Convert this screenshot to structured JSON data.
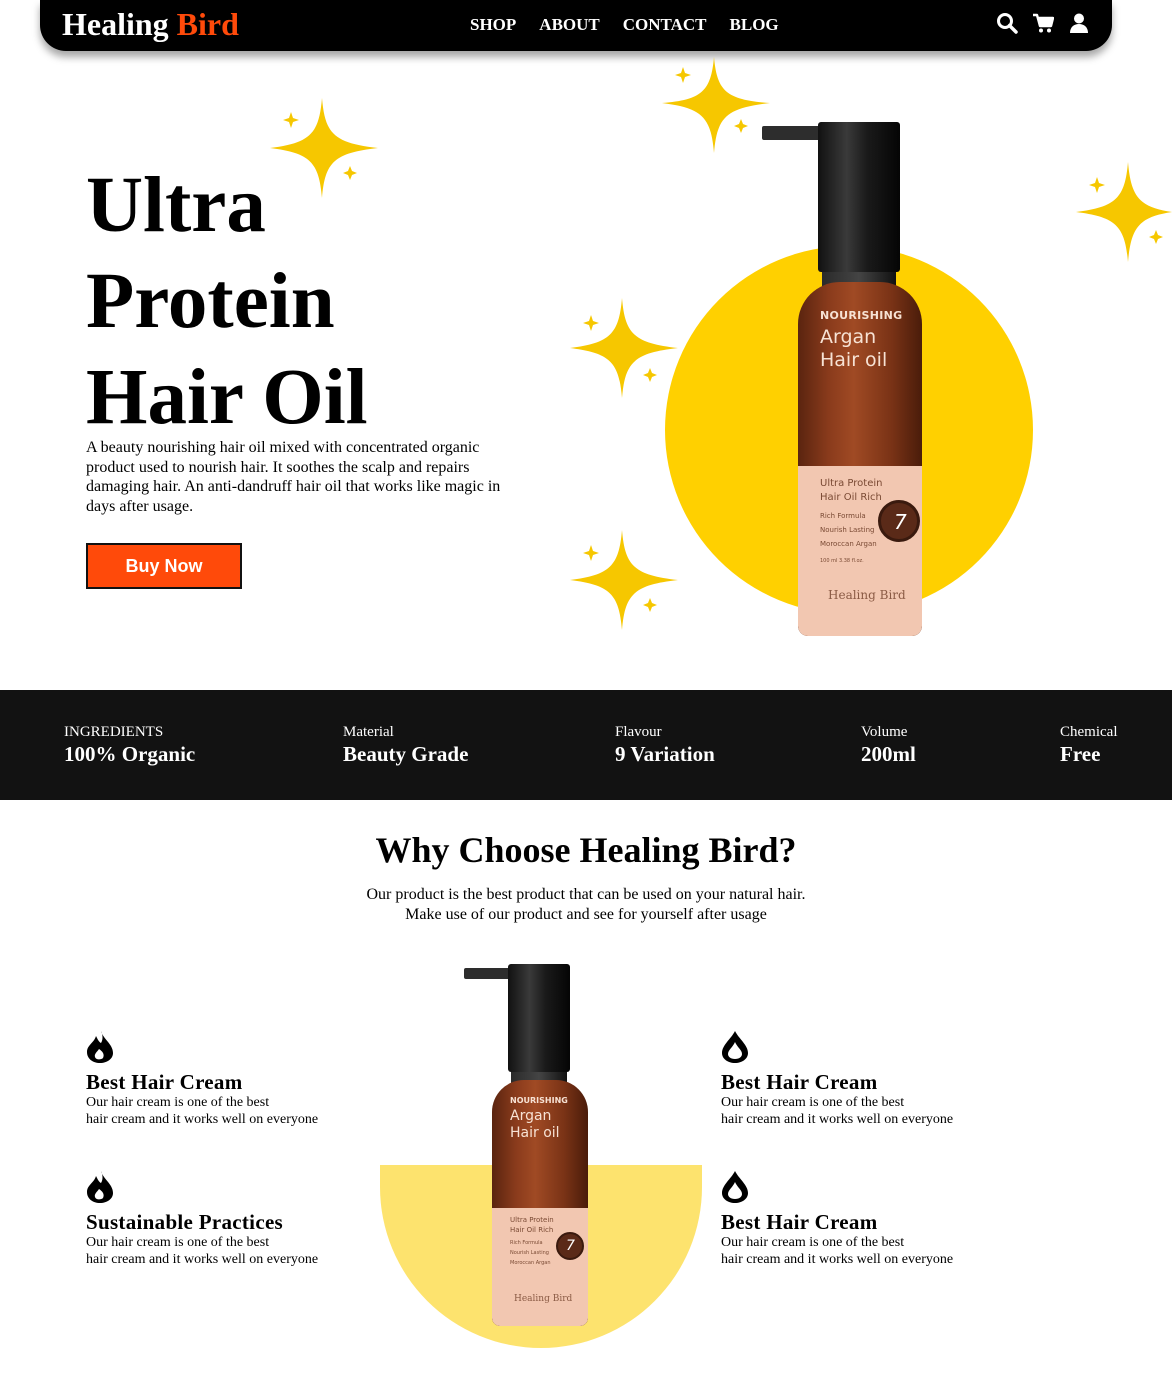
{
  "nav": {
    "brand_first": "Healing",
    "brand_second": "Bird",
    "links": [
      "SHOP",
      "ABOUT",
      "CONTACT",
      "BLOG"
    ],
    "icons": [
      "search-icon",
      "cart-icon",
      "user-icon"
    ]
  },
  "hero": {
    "title_lines": [
      "Ultra",
      "Protein",
      "Hair Oil"
    ],
    "description": "A beauty nourishing hair oil mixed with concentrated organic product used to nourish hair. It soothes the scalp and repairs damaging hair. An anti-dandruff hair oil that works like magic in days after usage.",
    "button_label": "Buy Now"
  },
  "product_label": {
    "line1": "NOURISHING",
    "line2": "Argan",
    "line3": "Hair oil",
    "sub1": "Ultra Protein",
    "sub2": "Hair Oil Rich",
    "sub3": "Rich Formula",
    "sub4": "Nourish Lasting",
    "sub5": "Moroccan Argan",
    "volume": "100 ml 3.38 fl.oz.",
    "seal_number": "7",
    "brand": "Healing Bird"
  },
  "stats": [
    {
      "label": "INGREDIENTS",
      "value": "100% Organic"
    },
    {
      "label": "Material",
      "value": "Beauty Grade"
    },
    {
      "label": "Flavour",
      "value": "9 Variation"
    },
    {
      "label": "Volume",
      "value": "200ml"
    },
    {
      "label": "Chemical",
      "value": "Free"
    }
  ],
  "why": {
    "title": "Why Choose Healing Bird?",
    "subtitle_lines": [
      "Our product is the best product that can be used on your natural hair.",
      "Make use of our product and see for yourself after usage"
    ]
  },
  "features": [
    {
      "title": "Best Hair Cream",
      "lines": [
        "Our hair cream is one of the best",
        "hair cream and it works well on everyone"
      ],
      "icon": "flame-drop-icon"
    },
    {
      "title": "Best Hair Cream",
      "lines": [
        "Our hair cream is one of the best",
        "hair cream and it works well on everyone"
      ],
      "icon": "drop-outline-icon"
    },
    {
      "title": "Sustainable Practices",
      "lines": [
        "Our hair cream is one of the best",
        "hair cream and it works well on everyone"
      ],
      "icon": "flame-drop-icon"
    },
    {
      "title": "Best Hair Cream",
      "lines": [
        "Our hair cream is one of the best",
        "hair cream and it works well on everyone"
      ],
      "icon": "drop-outline-icon"
    }
  ],
  "colors": {
    "accent": "#ff4a0a",
    "sun": "#ffd000",
    "bowl": "#fde36e",
    "band": "#121212",
    "sparkle": "#f6c700"
  }
}
